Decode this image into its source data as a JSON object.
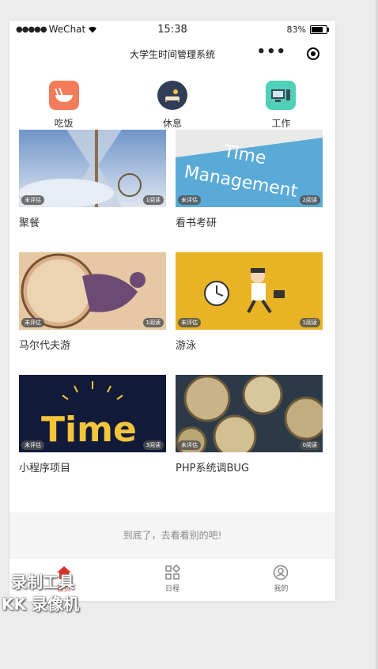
{
  "status_bar": {
    "carrier": "WeChat",
    "time": "15:38",
    "battery": "83%",
    "battery_level": 0.83
  },
  "nav": {
    "title": "大学生时间管理系统"
  },
  "categories": [
    {
      "label": "吃饭",
      "icon": "rice-bowl-icon",
      "color": "#f47c5a"
    },
    {
      "label": "休息",
      "icon": "sleep-icon",
      "color": "#2f3e56"
    },
    {
      "label": "工作",
      "icon": "computer-icon",
      "color": "#4fd0b8"
    }
  ],
  "items": [
    {
      "title": "聚餐",
      "status": "未评估",
      "reads": "1阅读",
      "image": "hourglass"
    },
    {
      "title": "看书考研",
      "status": "未评估",
      "reads": "2阅读",
      "image": "time-management"
    },
    {
      "title": "马尔代夫游",
      "status": "未评估",
      "reads": "1阅读",
      "image": "clock-runner"
    },
    {
      "title": "游泳",
      "status": "未评估",
      "reads": "1阅读",
      "image": "running-businessman"
    },
    {
      "title": "小程序项目",
      "status": "未评估",
      "reads": "3阅读",
      "image": "time-text"
    },
    {
      "title": "PHP系统调BUG",
      "status": "未评估",
      "reads": "0阅读",
      "image": "clock-gears"
    }
  ],
  "end_text": "到底了，去看看别的吧!",
  "tabs": [
    {
      "label": "首页",
      "icon": "home-icon",
      "active": true
    },
    {
      "label": "日程",
      "icon": "schedule-icon",
      "active": false
    },
    {
      "label": "我的",
      "icon": "profile-icon",
      "active": false
    }
  ],
  "watermark": {
    "line1": "录制工具",
    "line2": "KK 录像机"
  }
}
